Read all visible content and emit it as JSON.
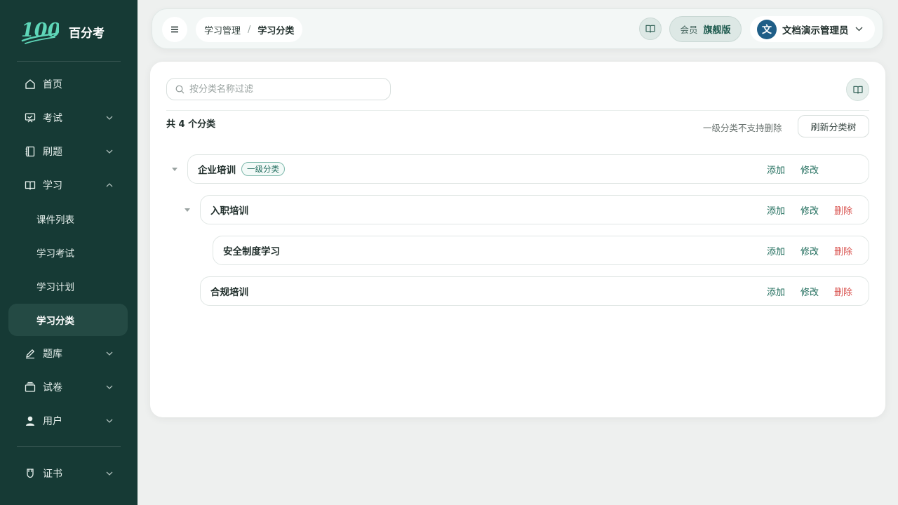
{
  "brand": {
    "logo_text": "100",
    "name": "百分考"
  },
  "sidebar": {
    "items": [
      {
        "label": "首页",
        "icon": "home-icon"
      },
      {
        "label": "考试",
        "icon": "exam-icon"
      },
      {
        "label": "刷题",
        "icon": "notebook-icon"
      },
      {
        "label": "学习",
        "icon": "book-icon"
      },
      {
        "label": "题库",
        "icon": "pen-icon"
      },
      {
        "label": "试卷",
        "icon": "paper-stack-icon"
      },
      {
        "label": "用户",
        "icon": "user-icon"
      },
      {
        "label": "证书",
        "icon": "certificate-icon"
      }
    ],
    "study_sub": [
      "课件列表",
      "学习考试",
      "学习计划",
      "学习分类"
    ]
  },
  "header": {
    "breadcrumb": [
      "学习管理",
      "学习分类"
    ],
    "breadcrumb_sep": "/",
    "member_label": "会员",
    "member_plan": "旗舰版",
    "user_avatar": "文",
    "user_name": "文档演示管理员"
  },
  "main": {
    "search_placeholder": "按分类名称过滤",
    "total_text": "共 4 个分类",
    "hint_text": "一级分类不支持删除",
    "refresh_label": "刷新分类树",
    "tree": [
      {
        "name": "企业培训",
        "tag": "一级分类",
        "add": "添加",
        "edit": "修改"
      },
      {
        "name": "入职培训",
        "add": "添加",
        "edit": "修改",
        "del": "删除"
      },
      {
        "name": "安全制度学习",
        "add": "添加",
        "edit": "修改",
        "del": "删除"
      },
      {
        "name": "合规培训",
        "add": "添加",
        "edit": "修改",
        "del": "删除"
      }
    ]
  },
  "colors": {
    "sidebar_bg": "#163a35",
    "accent": "#1d6b5a",
    "danger": "#d9534f"
  }
}
